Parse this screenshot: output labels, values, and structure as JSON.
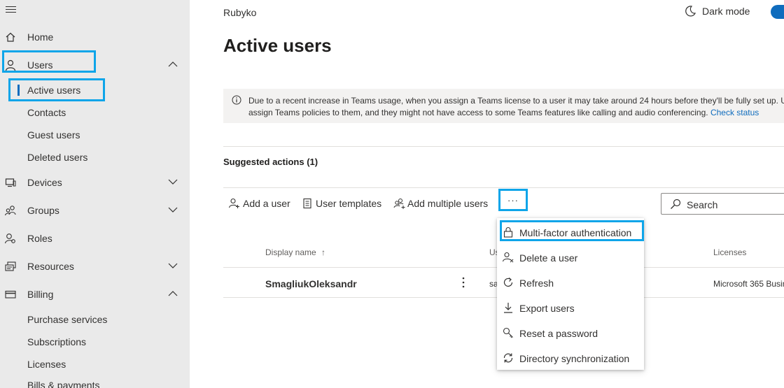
{
  "sidebar": {
    "home": "Home",
    "users": "Users",
    "users_sub": [
      "Active users",
      "Contacts",
      "Guest users",
      "Deleted users"
    ],
    "devices": "Devices",
    "groups": "Groups",
    "roles": "Roles",
    "resources": "Resources",
    "billing": "Billing",
    "billing_sub": [
      "Purchase services",
      "Subscriptions",
      "Licenses",
      "Bills & payments"
    ]
  },
  "header": {
    "org": "Rubyko",
    "dark_mode": "Dark mode",
    "page_title": "Active users"
  },
  "banner": {
    "text_line1": "Due to a recent increase in Teams usage, when you assign a Teams license to a user it may take around 24 hours before they'll be fully set up. Until",
    "text_line2": "assign Teams policies to them, and they might not have access to some Teams features like calling and audio conferencing.",
    "link": "Check status"
  },
  "suggested": "Suggested actions (1)",
  "toolbar": {
    "add_user": "Add a user",
    "user_templates": "User templates",
    "add_multiple": "Add multiple users",
    "more": "···",
    "search": "Search"
  },
  "menu": [
    "Multi-factor authentication",
    "Delete a user",
    "Refresh",
    "Export users",
    "Reset a password",
    "Directory synchronization"
  ],
  "table": {
    "col_display": "Display name",
    "sort_glyph": "↑",
    "col_user_partial": "Us",
    "col_licenses": "Licenses",
    "row": {
      "name": "SmagliukOleksandr",
      "user_partial": "sa",
      "license": "Microsoft 365 Busin"
    }
  },
  "colors": {
    "highlight": "#0ea5e9",
    "link": "#0f6cbd",
    "sidebar_bg": "#eaeaea",
    "banner_bg": "#f3f2f1"
  }
}
